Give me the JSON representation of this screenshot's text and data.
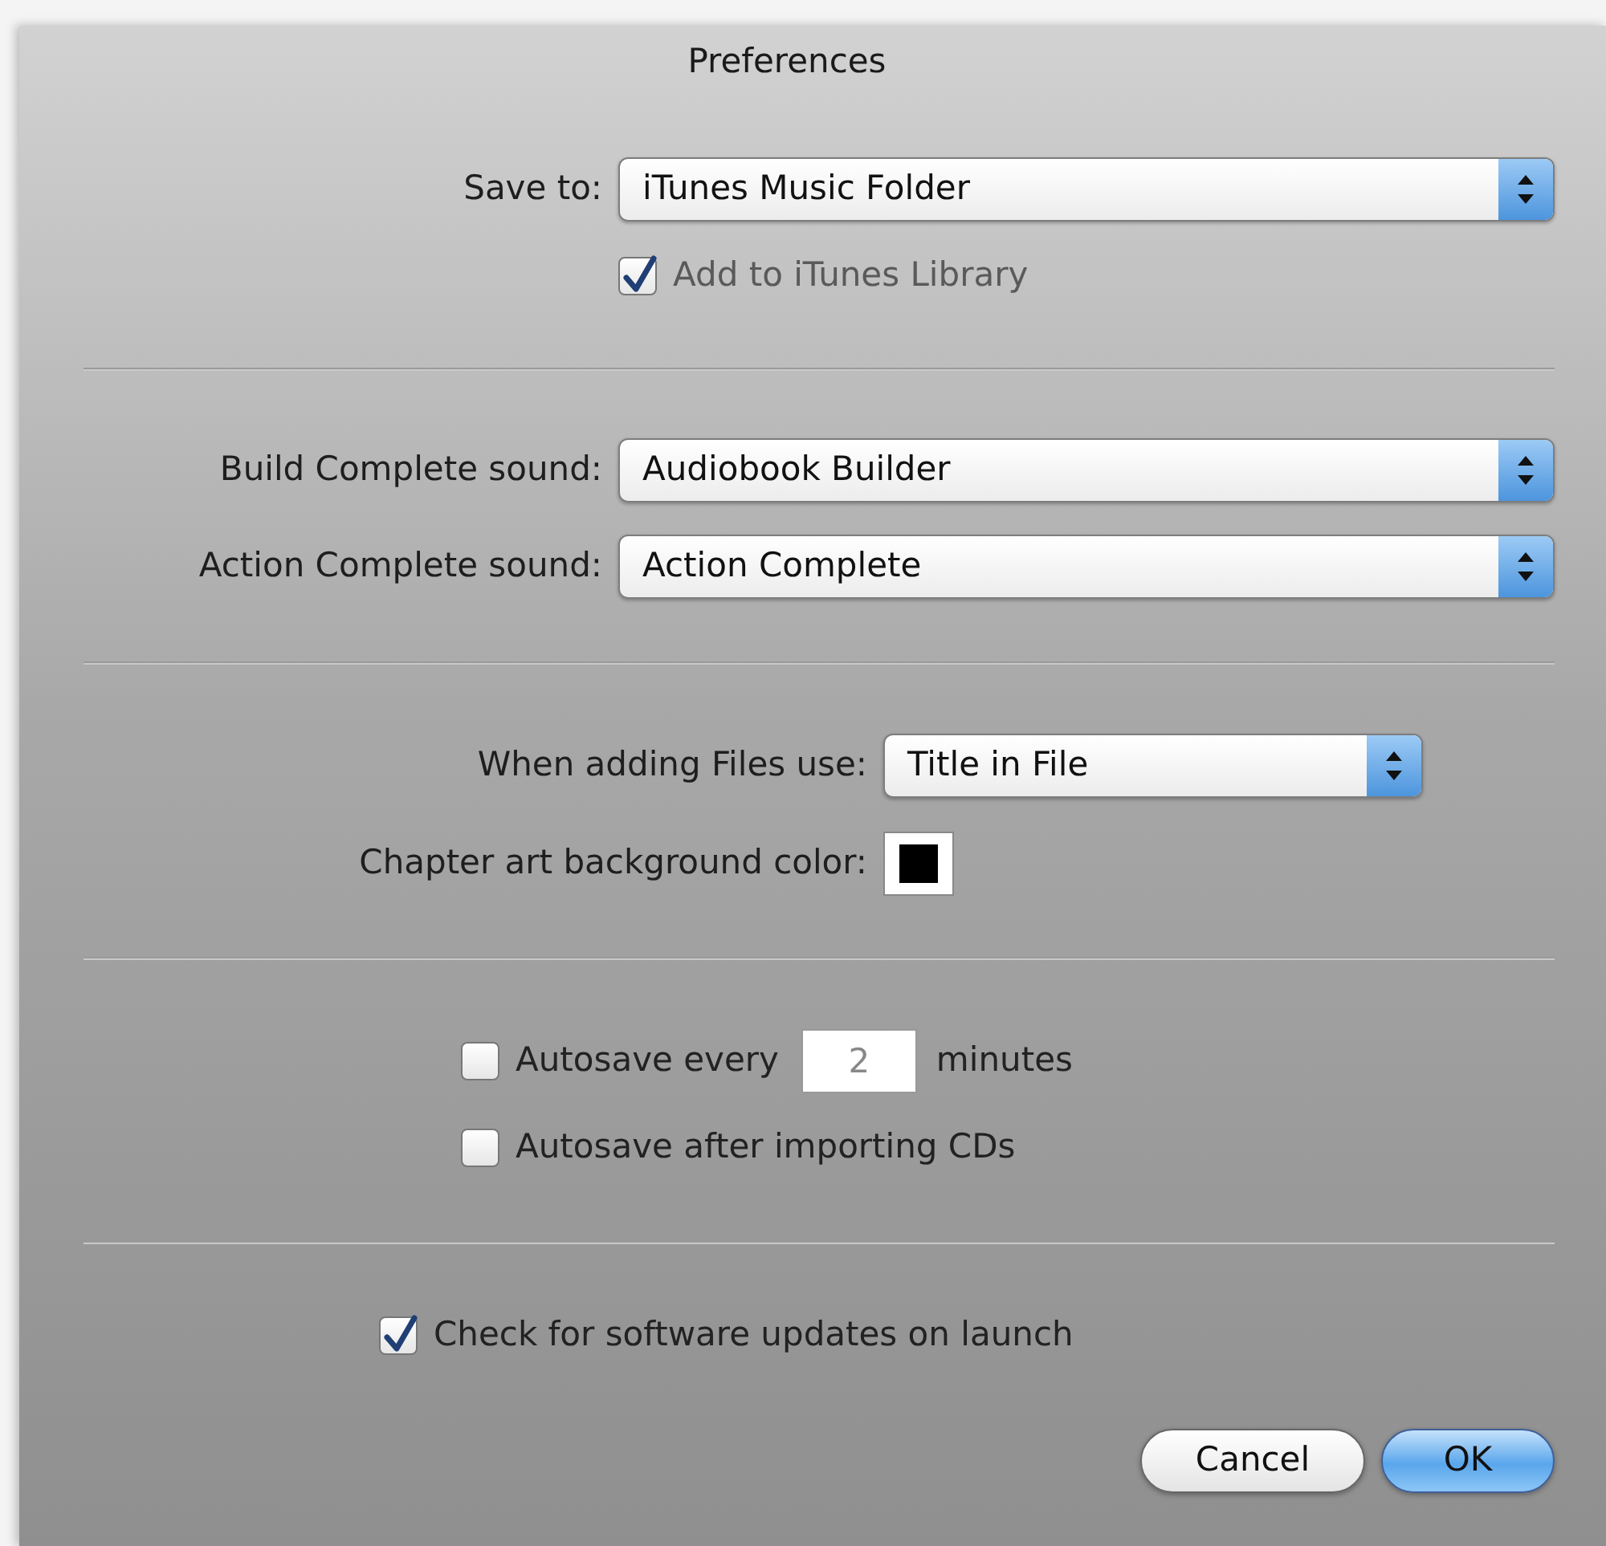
{
  "window": {
    "title": "Preferences"
  },
  "save_to": {
    "label": "Save to:",
    "value": "iTunes Music Folder",
    "add_to_library": {
      "label": "Add to iTunes Library",
      "checked": true,
      "disabled": true
    }
  },
  "sounds": [
    {
      "label": "Build Complete sound:",
      "value": "Audiobook Builder"
    },
    {
      "label": "Action Complete sound:",
      "value": "Action Complete"
    }
  ],
  "files": {
    "label": "When adding Files use:",
    "value": "Title in File"
  },
  "chapter_art": {
    "label": "Chapter art background color:",
    "color": "#000000"
  },
  "autosave": [
    {
      "kind": "interval",
      "label": "Autosave every",
      "value": "2",
      "unit": "minutes",
      "checked": false
    },
    {
      "kind": "plain",
      "label": "Autosave after importing CDs",
      "checked": false
    }
  ],
  "updates": {
    "label": "Check for software updates on launch",
    "checked": true
  },
  "buttons": [
    {
      "label": "Cancel",
      "default": false
    },
    {
      "label": "OK",
      "default": true
    }
  ]
}
